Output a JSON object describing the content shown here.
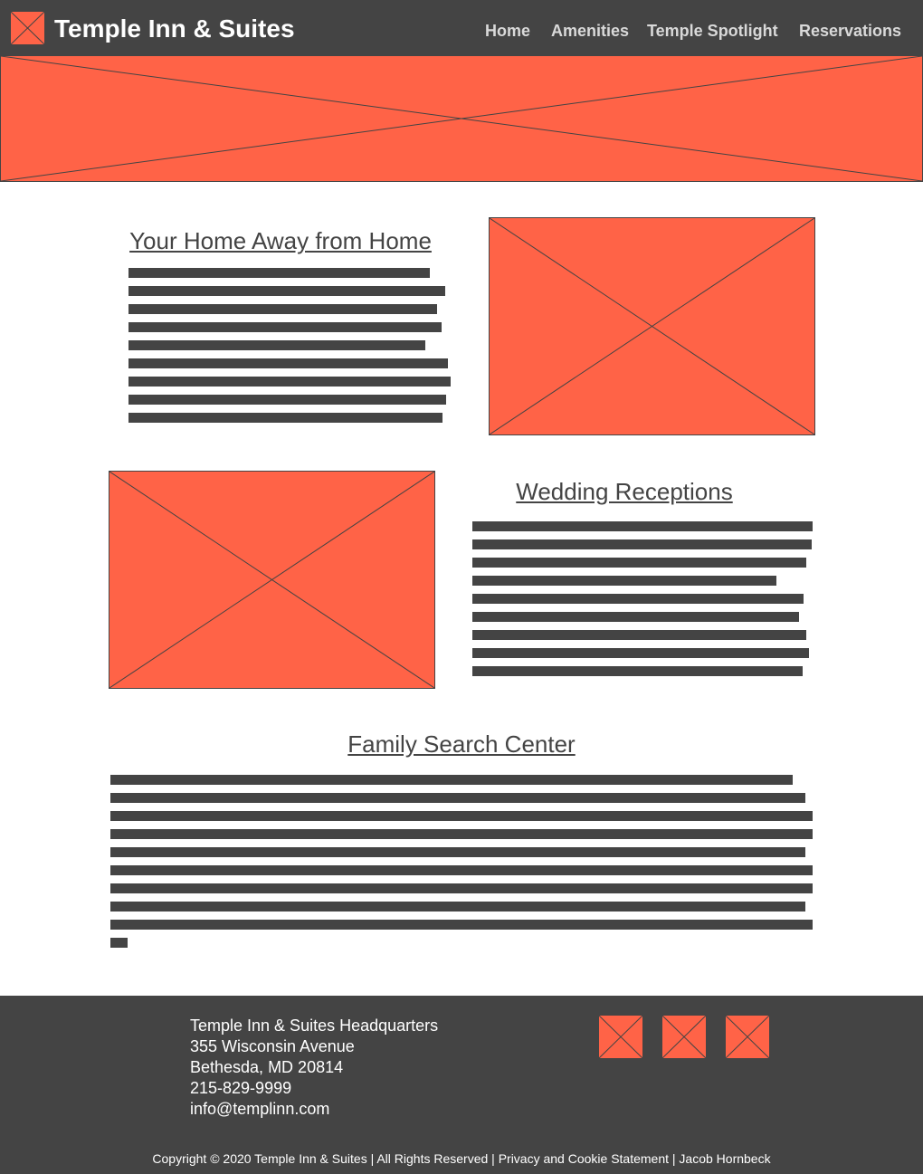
{
  "header": {
    "title": "Temple Inn & Suites",
    "logo_icon": "image-placeholder-icon",
    "nav": [
      "Home",
      "Amenities",
      "Temple Spotlight",
      "Reservations"
    ]
  },
  "sections": {
    "home": {
      "heading": "Your Home Away from Home"
    },
    "wedding": {
      "heading": "Wedding Receptions"
    },
    "family": {
      "heading": "Family Search Center"
    }
  },
  "footer": {
    "address_lines": [
      "Temple Inn & Suites Headquarters",
      "355 Wisconsin Avenue",
      "Bethesda, MD 20814",
      "215-829-9999",
      "info@templinn.com"
    ],
    "social_icons": [
      "image-placeholder-icon",
      "image-placeholder-icon",
      "image-placeholder-icon"
    ],
    "copyright": "Copyright © 2020 Temple Inn & Suites | All Rights Reserved | Privacy and Cookie Statement | Jacob Hornbeck"
  },
  "colors": {
    "placeholder_fill": "#ff6347",
    "dark": "#444444",
    "nav_text": "#d9d9d9",
    "white": "#ffffff"
  }
}
